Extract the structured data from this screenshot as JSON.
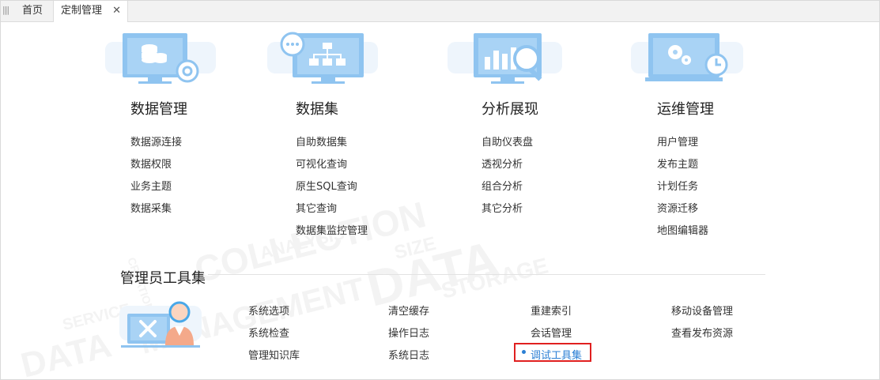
{
  "tabs": [
    {
      "label": "首页"
    },
    {
      "label": "定制管理",
      "close": "✕"
    }
  ],
  "modules": [
    {
      "title": "数据管理",
      "icon": "database-gear-icon",
      "links": [
        "数据源连接",
        "数据权限",
        "业务主题",
        "数据采集"
      ]
    },
    {
      "title": "数据集",
      "icon": "dataset-network-icon",
      "links": [
        "自助数据集",
        "可视化查询",
        "原生SQL查询",
        "其它查询",
        "数据集监控管理"
      ]
    },
    {
      "title": "分析展现",
      "icon": "chart-magnifier-icon",
      "links": [
        "自助仪表盘",
        "透视分析",
        "组合分析",
        "其它分析"
      ]
    },
    {
      "title": "运维管理",
      "icon": "gears-clock-icon",
      "links": [
        "用户管理",
        "发布主题",
        "计划任务",
        "资源迁移",
        "地图编辑器"
      ]
    }
  ],
  "admin": {
    "title": "管理员工具集",
    "icon": "admin-tools-icon",
    "columns": [
      [
        "系统选项",
        "系统检查",
        "管理知识库"
      ],
      [
        "清空缓存",
        "操作日志",
        "系统日志"
      ],
      [
        "重建索引",
        "会话管理",
        "调试工具集"
      ],
      [
        "移动设备管理",
        "查看发布资源"
      ]
    ],
    "highlighted": "调试工具集"
  },
  "colors": {
    "accent": "#2b7fd4",
    "icon_blue": "#8fc4f0",
    "highlight_border": "#e02020"
  }
}
